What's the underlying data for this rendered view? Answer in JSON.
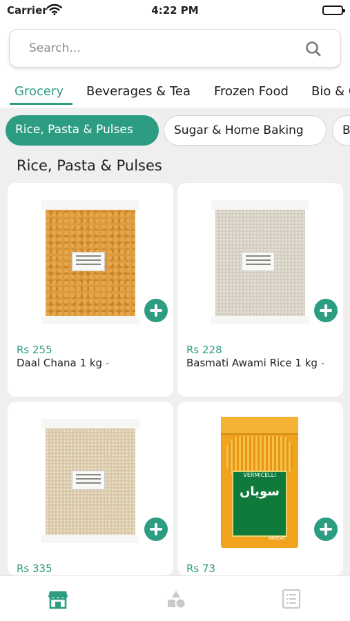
{
  "status_bar": {
    "carrier": "Carrier",
    "time": "4:22 PM"
  },
  "search": {
    "placeholder": "Search..."
  },
  "category_tabs": [
    {
      "label": "Grocery",
      "active": true
    },
    {
      "label": "Beverages & Tea",
      "active": false
    },
    {
      "label": "Frozen Food",
      "active": false
    },
    {
      "label": "Bio & G",
      "active": false
    }
  ],
  "subcategory_chips": [
    {
      "label": "Rice, Pasta  & Pulses",
      "active": true
    },
    {
      "label": "Sugar  & Home Baking",
      "active": false
    },
    {
      "label": "B",
      "active": false
    }
  ],
  "section": {
    "title": "Rice, Pasta  & Pulses"
  },
  "products": [
    {
      "price": "Rs 255",
      "name": "Daal Chana 1 kg",
      "suffix": "-",
      "image": "chana-dal-bag"
    },
    {
      "price": "Rs 228",
      "name": "Basmati Awami Rice 1 kg",
      "suffix": "-",
      "image": "basmati-rice-bag"
    },
    {
      "price": "Rs 335",
      "name": "",
      "suffix": "",
      "image": "rice-bag"
    },
    {
      "price": "Rs 73",
      "name": "",
      "suffix": "",
      "image": "vermicelli-pack",
      "brand_text": "VERMICELLI",
      "urdu_text": "سویاں",
      "badge_text": "WHEAT"
    }
  ],
  "bottom_nav": [
    {
      "icon": "store-icon",
      "active": true
    },
    {
      "icon": "categories-icon",
      "active": false
    },
    {
      "icon": "list-icon",
      "active": false
    }
  ],
  "colors": {
    "accent": "#2c9c82",
    "background": "#efefef"
  }
}
